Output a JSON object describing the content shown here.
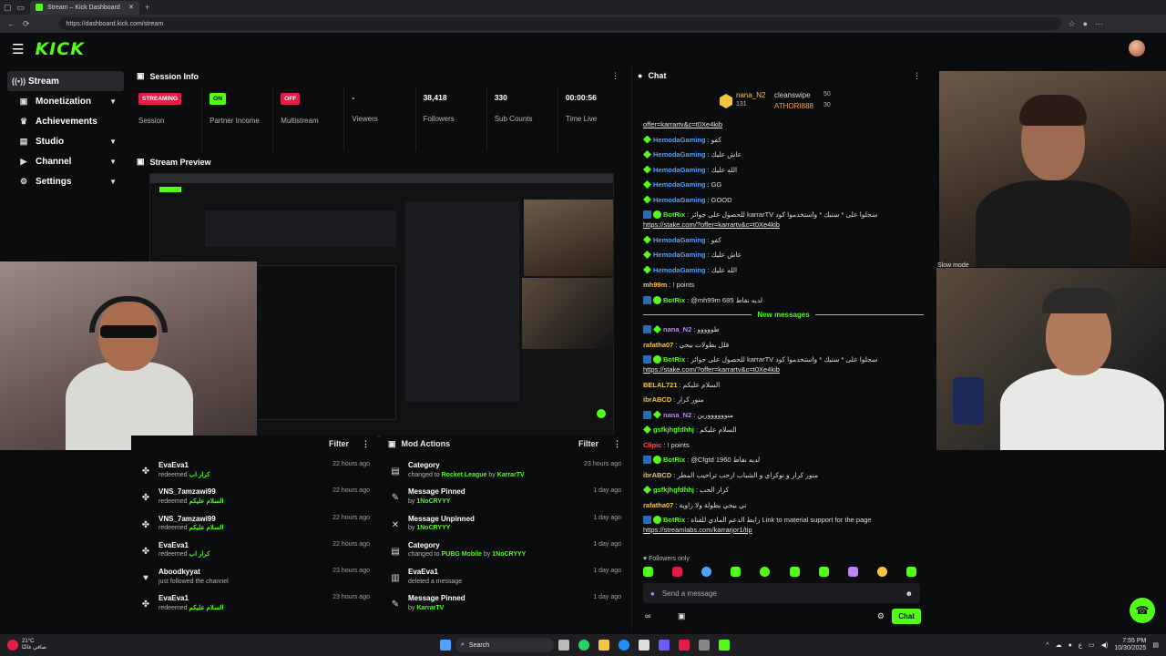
{
  "browser": {
    "tab_title": "Stream – Kick Dashboard",
    "url": "https://dashboard.kick.com/stream"
  },
  "app": {
    "logo": "KICK"
  },
  "sidebar": {
    "items": [
      {
        "label": "Stream",
        "icon": "broadcast-icon"
      },
      {
        "label": "Monetization",
        "icon": "money-icon"
      },
      {
        "label": "Achievements",
        "icon": "trophy-icon"
      },
      {
        "label": "Studio",
        "icon": "studio-icon"
      },
      {
        "label": "Channel",
        "icon": "channel-icon"
      },
      {
        "label": "Settings",
        "icon": "gear-icon"
      }
    ]
  },
  "session": {
    "title": "Session Info",
    "cells": [
      {
        "value": "STREAMING",
        "label": "Session"
      },
      {
        "value": "ON",
        "label": "Partner Income"
      },
      {
        "value": "OFF",
        "label": "Multistream"
      },
      {
        "value": "-",
        "label": "Viewers"
      },
      {
        "value": "38,418",
        "label": "Followers"
      },
      {
        "value": "330",
        "label": "Sub Counts"
      },
      {
        "value": "00:00:56",
        "label": "Time Live"
      }
    ]
  },
  "preview": {
    "title": "Stream Preview"
  },
  "chat": {
    "title": "Chat",
    "pinned": {
      "top_user": "nana_N2",
      "top_count": "131",
      "second_user": "cleanswipe",
      "second_count": "50",
      "third_user": "ATHORI888",
      "third_count": "30"
    },
    "messages": [
      {
        "user": "",
        "text": "offer=karrartv&c=t0Xe4kib",
        "color": "#e6e6e6",
        "kind": "link"
      },
      {
        "user": "HemodaGaming",
        "text": "كفو",
        "color": "#4da3ff"
      },
      {
        "user": "HemodaGaming",
        "text": "عاش عليك",
        "color": "#4da3ff"
      },
      {
        "user": "HemodaGaming",
        "text": "الله عليك",
        "color": "#4da3ff"
      },
      {
        "user": "HemodaGaming",
        "text": "GG",
        "color": "#4da3ff"
      },
      {
        "user": "HemodaGaming",
        "text": "GOOD",
        "color": "#4da3ff"
      },
      {
        "user": "BotRix",
        "text": "للحصول على جوائز karrarTV سجلوا على * ستيك * واستخدموا كود",
        "link": "https://stake.com/?offer=karrartv&c=t0Xe4kib",
        "color": "#53fc18"
      },
      {
        "user": "HemodaGaming",
        "text": "كفو",
        "color": "#4da3ff"
      },
      {
        "user": "HemodaGaming",
        "text": "عاش عليك",
        "color": "#4da3ff"
      },
      {
        "user": "HemodaGaming",
        "text": "الله عليك",
        "color": "#4da3ff"
      },
      {
        "user": "mh99m",
        "text": "! points",
        "color": "#f5c542"
      },
      {
        "user": "BotRix",
        "text": "@mh99m 685 لديه نقاط",
        "color": "#53fc18"
      }
    ],
    "new_messages_label": "New messages",
    "messages_new": [
      {
        "user": "nana_N2",
        "text": "طووووو",
        "color": "#c084fc"
      },
      {
        "user": "rafatha07",
        "text": "قلل بطولات بيجي",
        "color": "#f5c542"
      },
      {
        "user": "BotRix",
        "text": "للحصول على جوائز karrarTV سجلوا على * ستيك * واستخدموا كود",
        "link": "https://stake.com/?offer=karrartv&c=t0Xe4kib",
        "color": "#53fc18"
      },
      {
        "user": "BELAL721",
        "text": "السلام عليكم",
        "color": "#f5c542"
      },
      {
        "user": "ibrABCD",
        "text": "منور كرار",
        "color": "#f5c542"
      },
      {
        "user": "nana_N2",
        "text": "منوووووورين",
        "color": "#c084fc"
      },
      {
        "user": "gsfkjhgfdhhj",
        "text": "السلام عليكم",
        "color": "#53fc18"
      },
      {
        "user": "Clipic",
        "text": "! points",
        "color": "#ff4d4d"
      },
      {
        "user": "BotRix",
        "text": "@Cfgtd 1960 لديه نقاط",
        "color": "#53fc18"
      },
      {
        "user": "ibrABCD",
        "text": "منور كرار و نوكراي و الشباب ارحب تراحيب المطر",
        "color": "#f5c542"
      },
      {
        "user": "gsfkjhgfdhhj",
        "text": "كرار الحب",
        "color": "#53fc18"
      },
      {
        "user": "rafatha07",
        "text": "ني بيجي بطولة ولا زاوية",
        "color": "#f5c542"
      },
      {
        "user": "BotRix",
        "text": "رابط الدعم المادي للقناة Link to material support for the page",
        "link": "https://streamlabs.com/karrarjor1/tip",
        "color": "#53fc18"
      }
    ],
    "followers_only": "Followers only",
    "input_placeholder": "Send a message",
    "send_label": "Chat",
    "slow_mode": "Slow mode"
  },
  "redeems": {
    "filter_label": "Filter",
    "rows": [
      {
        "user": "EvaEva1",
        "action": "redeemed",
        "reward": "كرار اب",
        "time": "22 hours ago"
      },
      {
        "user": "VNS_7amzawi99",
        "action": "redeemed",
        "reward": "السلام عليكم",
        "time": "22 hours ago"
      },
      {
        "user": "VNS_7amzawi99",
        "action": "redeemed",
        "reward": "السلام عليكم",
        "time": "22 hours ago"
      },
      {
        "user": "EvaEva1",
        "action": "redeemed",
        "reward": "كرار اب",
        "time": "22 hours ago"
      },
      {
        "user": "Aboodkyyat",
        "action": "just followed the channel",
        "reward": "",
        "time": "23 hours ago"
      },
      {
        "user": "EvaEva1",
        "action": "redeemed",
        "reward": "السلام عليكم",
        "time": "23 hours ago"
      }
    ]
  },
  "mod_actions": {
    "title": "Mod Actions",
    "filter_label": "Filter",
    "rows": [
      {
        "title": "Category",
        "detail_pre": "changed to",
        "detail_hl": "Rocket League",
        "detail_by": "by",
        "actor": "KarrarTV",
        "time": "23 hours ago",
        "icon": "category-icon"
      },
      {
        "title": "Message Pinned",
        "detail_pre": "",
        "detail_hl": "",
        "detail_by": "by",
        "actor": "1NoCRYYY",
        "time": "1 day ago",
        "icon": "pin-icon"
      },
      {
        "title": "Message Unpinned",
        "detail_pre": "",
        "detail_hl": "",
        "detail_by": "by",
        "actor": "1NoCRYYY",
        "time": "1 day ago",
        "icon": "unpin-icon"
      },
      {
        "title": "Category",
        "detail_pre": "changed to",
        "detail_hl": "PUBG Mobile",
        "detail_by": "by",
        "actor": "1NoCRYYY",
        "time": "1 day ago",
        "icon": "category-icon"
      },
      {
        "title": "EvaEva1",
        "detail_pre": "deleted a message",
        "detail_hl": "",
        "detail_by": "",
        "actor": "",
        "time": "1 day ago",
        "icon": "trash-icon"
      },
      {
        "title": "Message Pinned",
        "detail_pre": "",
        "detail_hl": "",
        "detail_by": "by",
        "actor": "KarrarTV",
        "time": "1 day ago",
        "icon": "pin-icon"
      }
    ]
  },
  "taskbar": {
    "weather_temp": "21°C",
    "weather_text": "صافي غالبًا",
    "search": "Search",
    "lang": "ع",
    "time": "7:55 PM",
    "date": "10/30/2025"
  },
  "colors": {
    "accent": "#53fc18",
    "bg": "#0b0c0e",
    "danger": "#e11d48"
  }
}
